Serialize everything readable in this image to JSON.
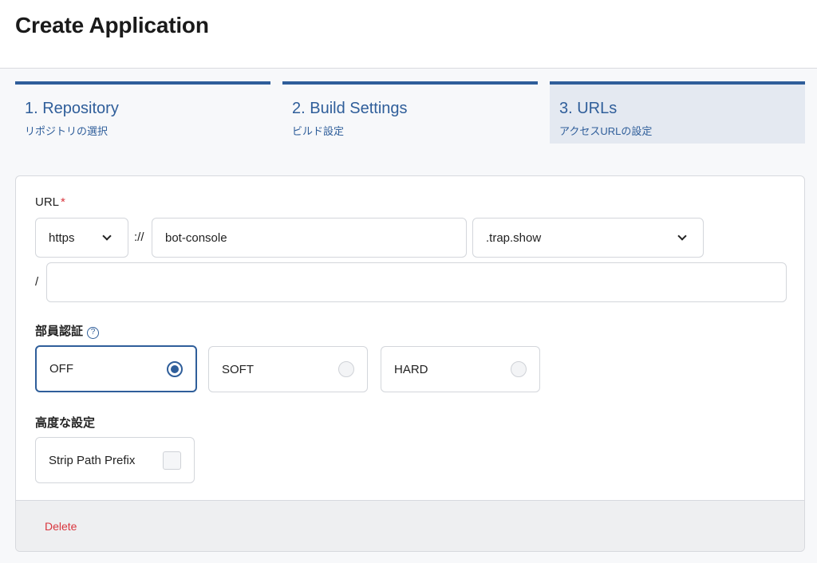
{
  "header": {
    "title": "Create Application"
  },
  "steps": [
    {
      "title": "1. Repository",
      "subtitle": "リポジトリの選択"
    },
    {
      "title": "2. Build Settings",
      "subtitle": "ビルド設定"
    },
    {
      "title": "3. URLs",
      "subtitle": "アクセスURLの設定"
    }
  ],
  "active_step": 3,
  "url": {
    "label": "URL",
    "required_mark": "*",
    "scheme": "https",
    "scheme_separator": "://",
    "subdomain": "bot-console",
    "domain": ".trap.show",
    "path_prefix": "/",
    "path": ""
  },
  "auth": {
    "label": "部員認証",
    "help_icon": "question-circle-icon",
    "options": [
      {
        "label": "OFF",
        "selected": true
      },
      {
        "label": "SOFT",
        "selected": false
      },
      {
        "label": "HARD",
        "selected": false
      }
    ]
  },
  "advanced": {
    "label": "高度な設定",
    "strip_path_prefix_label": "Strip Path Prefix",
    "strip_path_prefix_checked": false
  },
  "footer": {
    "delete_label": "Delete"
  },
  "colors": {
    "accent": "#2f5e9a",
    "danger": "#d9363e"
  }
}
